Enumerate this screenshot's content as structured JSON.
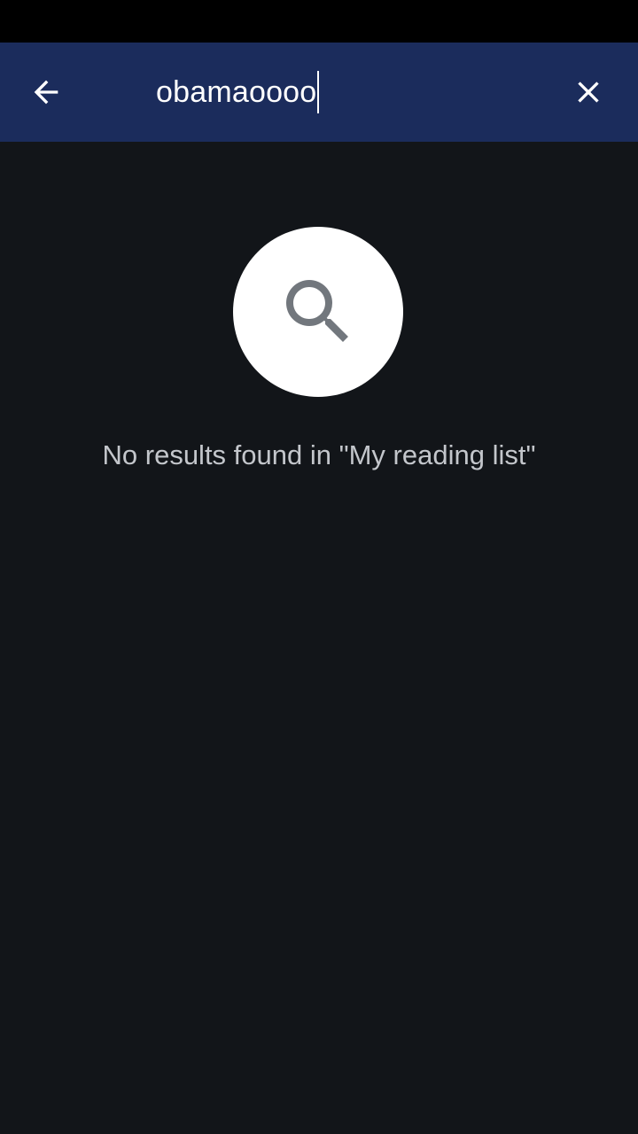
{
  "app_bar": {
    "search": {
      "value": "obamaoooo"
    },
    "back_icon": "arrow-left-icon",
    "clear_icon": "close-icon",
    "background_color": "#1b2c5c"
  },
  "empty_state": {
    "icon": "search-icon",
    "message": "No results found in \"My reading list\""
  },
  "colors": {
    "background": "#121519",
    "status_bar": "#000000",
    "icon_gray": "#72777d"
  }
}
